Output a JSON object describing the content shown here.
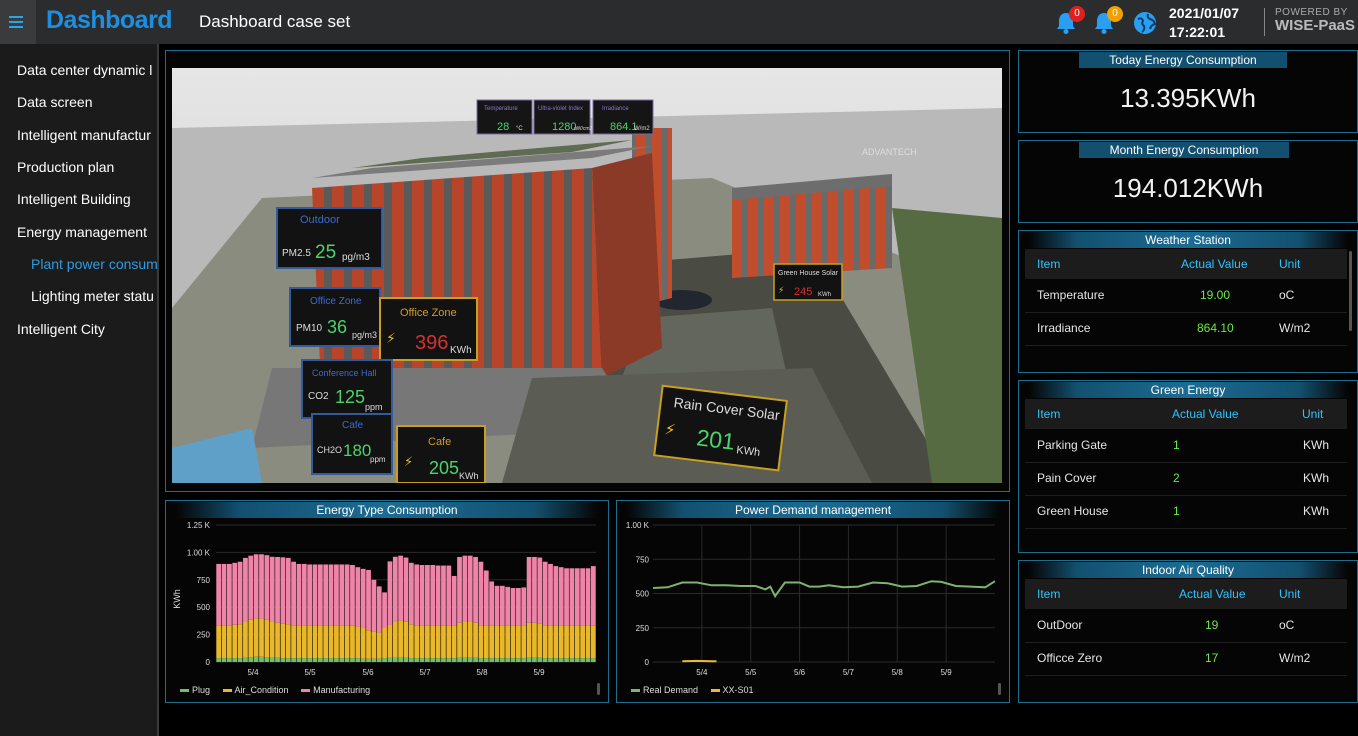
{
  "topbar": {
    "brand": "Dashboard",
    "title": "Dashboard case set",
    "notifications_red": "0",
    "notifications_orange": "0",
    "date": "2021/01/07",
    "time": "17:22:01",
    "powered_by": "POWERED BY",
    "platform": "WISE-PaaS"
  },
  "sidebar": {
    "items": [
      {
        "label": "Data center dynamic l",
        "level": 0
      },
      {
        "label": "Data screen",
        "level": 0
      },
      {
        "label": "Intelligent manufactur",
        "level": 0
      },
      {
        "label": "Production plan",
        "level": 0
      },
      {
        "label": "Intelligent Building",
        "level": 0
      },
      {
        "label": "Energy management",
        "level": 0
      },
      {
        "label": "Plant power consum",
        "level": 1,
        "active": true
      },
      {
        "label": "Lighting meter statu",
        "level": 1
      },
      {
        "label": "Intelligent City",
        "level": 0
      }
    ]
  },
  "scene": {
    "roof_labels": [
      {
        "name": "Temperature",
        "value": "28",
        "unit": "°C"
      },
      {
        "name": "Ultra-violet Index",
        "value": "1280",
        "unit": "uW/cm2"
      },
      {
        "name": "Irradiance",
        "value": "864.1",
        "unit": "W/m2"
      }
    ],
    "outdoor": {
      "title": "Outdoor",
      "metric": "PM2.5",
      "value": "25",
      "unit": "pg/m3"
    },
    "office_zone_aq": {
      "title": "Office Zone",
      "metric": "PM10",
      "value": "36",
      "unit": "pg/m3"
    },
    "office_zone_energy": {
      "title": "Office Zone",
      "value": "396",
      "unit": "KWh"
    },
    "conference_hall": {
      "title": "Conference Hall",
      "metric": "CO2",
      "value": "125",
      "unit": "ppm"
    },
    "cafe_aq": {
      "title": "Cafe",
      "metric": "CH2O",
      "value": "180",
      "unit": "ppm"
    },
    "cafe_energy": {
      "title": "Cafe",
      "value": "205",
      "unit": "KWh"
    },
    "rain_cover_solar": {
      "title": "Rain Cover Solar",
      "value": "201",
      "unit": "KWh"
    },
    "green_house_solar": {
      "title": "Green House Solar",
      "value": "245",
      "unit": "KWh"
    },
    "advantech_sign": "ADVANTECH"
  },
  "today": {
    "title": "Today Energy Consumption",
    "value": "13.395KWh"
  },
  "month": {
    "title": "Month Energy Consumption",
    "value": "194.012KWh"
  },
  "weather": {
    "title": "Weather Station",
    "headers": [
      "Item",
      "Actual Value",
      "Unit"
    ],
    "rows": [
      {
        "item": "Temperature",
        "value": "19.00",
        "unit": "oC"
      },
      {
        "item": "Irradiance",
        "value": "864.10",
        "unit": "W/m2"
      }
    ]
  },
  "green_energy": {
    "title": "Green Energy",
    "headers": [
      "Item",
      "Actual Value",
      "Unit"
    ],
    "rows": [
      {
        "item": "Parking Gate",
        "value": "1",
        "unit": "KWh"
      },
      {
        "item": "Pain Cover",
        "value": "2",
        "unit": "KWh"
      },
      {
        "item": "Green House",
        "value": "1",
        "unit": "KWh"
      }
    ]
  },
  "air_quality": {
    "title": "Indoor Air Quality",
    "headers": [
      "Item",
      "Actual Value",
      "Unit"
    ],
    "rows": [
      {
        "item": "OutDoor",
        "value": "19",
        "unit": "oC"
      },
      {
        "item": "Officce Zero",
        "value": "17",
        "unit": "W/m2"
      }
    ]
  },
  "colors": {
    "accent": "#1e8fe0",
    "panel_border": "#1e6f8e",
    "value_green": "#6de84a",
    "header_cyan": "#2fc3ff",
    "plug": "#73bf69",
    "air_condition": "#e9b72a",
    "manufacturing": "#f084a8",
    "real_demand": "#7eb26d",
    "xx_s01": "#eab839"
  },
  "chart_data": [
    {
      "type": "bar",
      "title": "Energy Type Consumption",
      "ylabel": "KWh",
      "xlabel": "",
      "ylim": [
        0,
        1250
      ],
      "yticks": [
        "0",
        "250",
        "500",
        "750",
        "1.00 K",
        "1.25 K"
      ],
      "xticks": [
        "5/4",
        "5/5",
        "5/6",
        "5/7",
        "5/8",
        "5/9"
      ],
      "stacked": true,
      "grid": true,
      "legend": "bottom-left",
      "series": [
        {
          "name": "Plug",
          "color": "#73bf69",
          "values": [
            35,
            35,
            35,
            35,
            35,
            40,
            45,
            48,
            48,
            45,
            40,
            38,
            35,
            35,
            35,
            35,
            35,
            35,
            35,
            35,
            35,
            35,
            35,
            35,
            35,
            35,
            35,
            30,
            30,
            30,
            30,
            35,
            38,
            40,
            40,
            38,
            35,
            35,
            35,
            35,
            35,
            35,
            35,
            35,
            35,
            38,
            40,
            40,
            38,
            35,
            35,
            35,
            35,
            35,
            35,
            35,
            35,
            35,
            38,
            38,
            38,
            35,
            35,
            35,
            35,
            35,
            35,
            35,
            35,
            35,
            35
          ]
        },
        {
          "name": "Air_Condition",
          "color": "#e9b72a",
          "values": [
            300,
            300,
            300,
            305,
            310,
            330,
            340,
            350,
            350,
            345,
            330,
            320,
            315,
            310,
            300,
            300,
            300,
            300,
            300,
            300,
            300,
            300,
            300,
            300,
            300,
            295,
            290,
            280,
            260,
            250,
            240,
            280,
            300,
            330,
            340,
            330,
            310,
            300,
            300,
            300,
            300,
            300,
            300,
            300,
            300,
            320,
            330,
            330,
            320,
            300,
            300,
            300,
            300,
            300,
            300,
            300,
            300,
            300,
            320,
            320,
            315,
            300,
            300,
            300,
            300,
            300,
            300,
            300,
            300,
            300,
            300
          ]
        },
        {
          "name": "Manufacturing",
          "color": "#f084a8",
          "values": [
            560,
            560,
            560,
            565,
            570,
            580,
            585,
            585,
            585,
            585,
            590,
            600,
            605,
            605,
            580,
            560,
            560,
            555,
            555,
            555,
            555,
            555,
            555,
            555,
            555,
            555,
            540,
            540,
            550,
            470,
            420,
            320,
            580,
            590,
            590,
            585,
            560,
            555,
            550,
            550,
            550,
            545,
            545,
            545,
            450,
            600,
            600,
            600,
            600,
            580,
            500,
            400,
            360,
            360,
            350,
            340,
            340,
            345,
            600,
            600,
            600,
            580,
            560,
            540,
            530,
            520,
            520,
            520,
            520,
            520,
            540
          ]
        }
      ]
    },
    {
      "type": "line",
      "title": "Power Demand management",
      "ylim": [
        0,
        1000
      ],
      "yticks": [
        "0",
        "250",
        "500",
        "750",
        "1.00 K"
      ],
      "xticks": [
        "5/4",
        "5/5",
        "5/6",
        "5/7",
        "5/8",
        "5/9"
      ],
      "grid": true,
      "legend": "bottom-left",
      "series": [
        {
          "name": "Real Demand",
          "color": "#7eb26d",
          "x": [
            0,
            0.3,
            0.6,
            0.9,
            1.2,
            1.5,
            1.8,
            2.1,
            2.3,
            2.4,
            2.5,
            2.7,
            3.0,
            3.2,
            3.4,
            3.6,
            3.9,
            4.2,
            4.5,
            4.8,
            5.1,
            5.4,
            5.7,
            5.9,
            6.2,
            6.5,
            6.8,
            7.0
          ],
          "values": [
            540,
            545,
            580,
            580,
            560,
            560,
            555,
            555,
            530,
            550,
            480,
            580,
            580,
            550,
            550,
            560,
            545,
            550,
            580,
            575,
            550,
            555,
            590,
            585,
            555,
            550,
            545,
            590
          ]
        },
        {
          "name": "XX-S01",
          "color": "#eab839",
          "x": [
            0.6,
            0.9,
            1.2,
            1.3
          ],
          "values": [
            5,
            8,
            6,
            5
          ]
        }
      ]
    }
  ]
}
